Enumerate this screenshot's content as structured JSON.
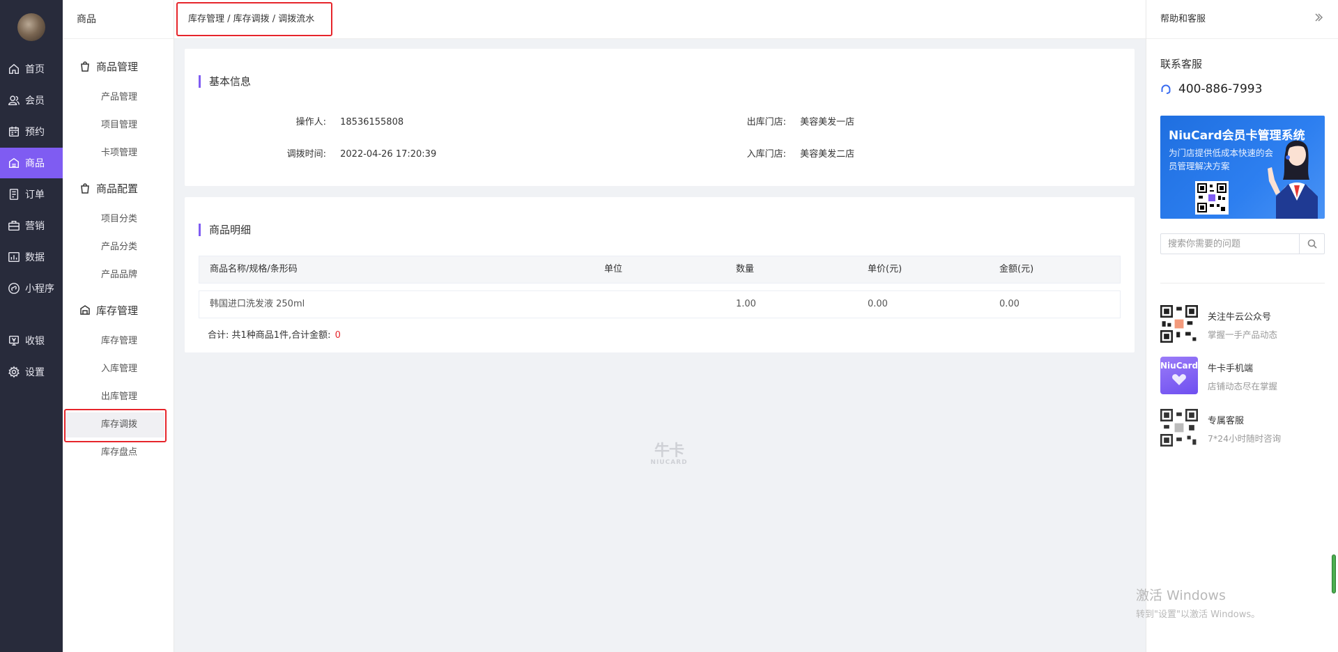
{
  "nav": {
    "items": [
      {
        "label": "首页",
        "icon": "home-icon"
      },
      {
        "label": "会员",
        "icon": "members-icon"
      },
      {
        "label": "预约",
        "icon": "calendar-icon"
      },
      {
        "label": "商品",
        "icon": "shop-icon",
        "active": true
      },
      {
        "label": "订单",
        "icon": "order-icon"
      },
      {
        "label": "营销",
        "icon": "marketing-icon"
      },
      {
        "label": "数据",
        "icon": "chart-icon"
      },
      {
        "label": "小程序",
        "icon": "miniprogram-icon"
      },
      {
        "label": "收银",
        "icon": "cashier-icon"
      },
      {
        "label": "设置",
        "icon": "gear-icon"
      }
    ],
    "active_color": "#7f5cf2"
  },
  "submenu": {
    "title": "商品",
    "groups": [
      {
        "label": "商品管理",
        "items": [
          "产品管理",
          "项目管理",
          "卡项管理"
        ]
      },
      {
        "label": "商品配置",
        "items": [
          "项目分类",
          "产品分类",
          "产品品牌"
        ]
      },
      {
        "label": "库存管理",
        "items": [
          "库存管理",
          "入库管理",
          "出库管理",
          "库存调拨",
          "库存盘点"
        ]
      }
    ],
    "active_item": "库存调拨"
  },
  "breadcrumb": "库存管理 / 库存调拨 / 调拨流水",
  "basic_info": {
    "title": "基本信息",
    "operator_label": "操作人:",
    "operator": "18536155808",
    "time_label": "调拨时间:",
    "time": "2022-04-26 17:20:39",
    "out_store_label": "出库门店:",
    "out_store": "美容美发一店",
    "in_store_label": "入库门店:",
    "in_store": "美容美发二店"
  },
  "detail": {
    "title": "商品明细",
    "columns": [
      "商品名称/规格/条形码",
      "单位",
      "数量",
      "单价(元)",
      "金额(元)"
    ],
    "rows": [
      {
        "name": "韩国进口洗发液 250ml",
        "unit": "",
        "qty": "1.00",
        "price": "0.00",
        "amount": "0.00"
      }
    ],
    "summary_label": "合计: 共1种商品1件,合计金额:",
    "summary_total": "0"
  },
  "watermark": {
    "cn": "牛卡",
    "en": "NIUCARD"
  },
  "right_panel": {
    "title": "帮助和客服",
    "contact_title": "联系客服",
    "phone": "400-886-7993",
    "banner_title": "NiuCard会员卡管理系统",
    "banner_sub": "为门店提供低成本快速的会员管理解决方案",
    "search_placeholder": "搜索你需要的问题",
    "cards": [
      {
        "title": "关注牛云公众号",
        "sub": "掌握一手产品动态"
      },
      {
        "title": "牛卡手机端",
        "sub": "店铺动态尽在掌握",
        "brand": "NiuCard"
      },
      {
        "title": "专属客服",
        "sub": "7*24小时随时咨询"
      }
    ]
  },
  "windows": {
    "line1": "激活 Windows",
    "line2": "转到\"设置\"以激活 Windows。"
  }
}
